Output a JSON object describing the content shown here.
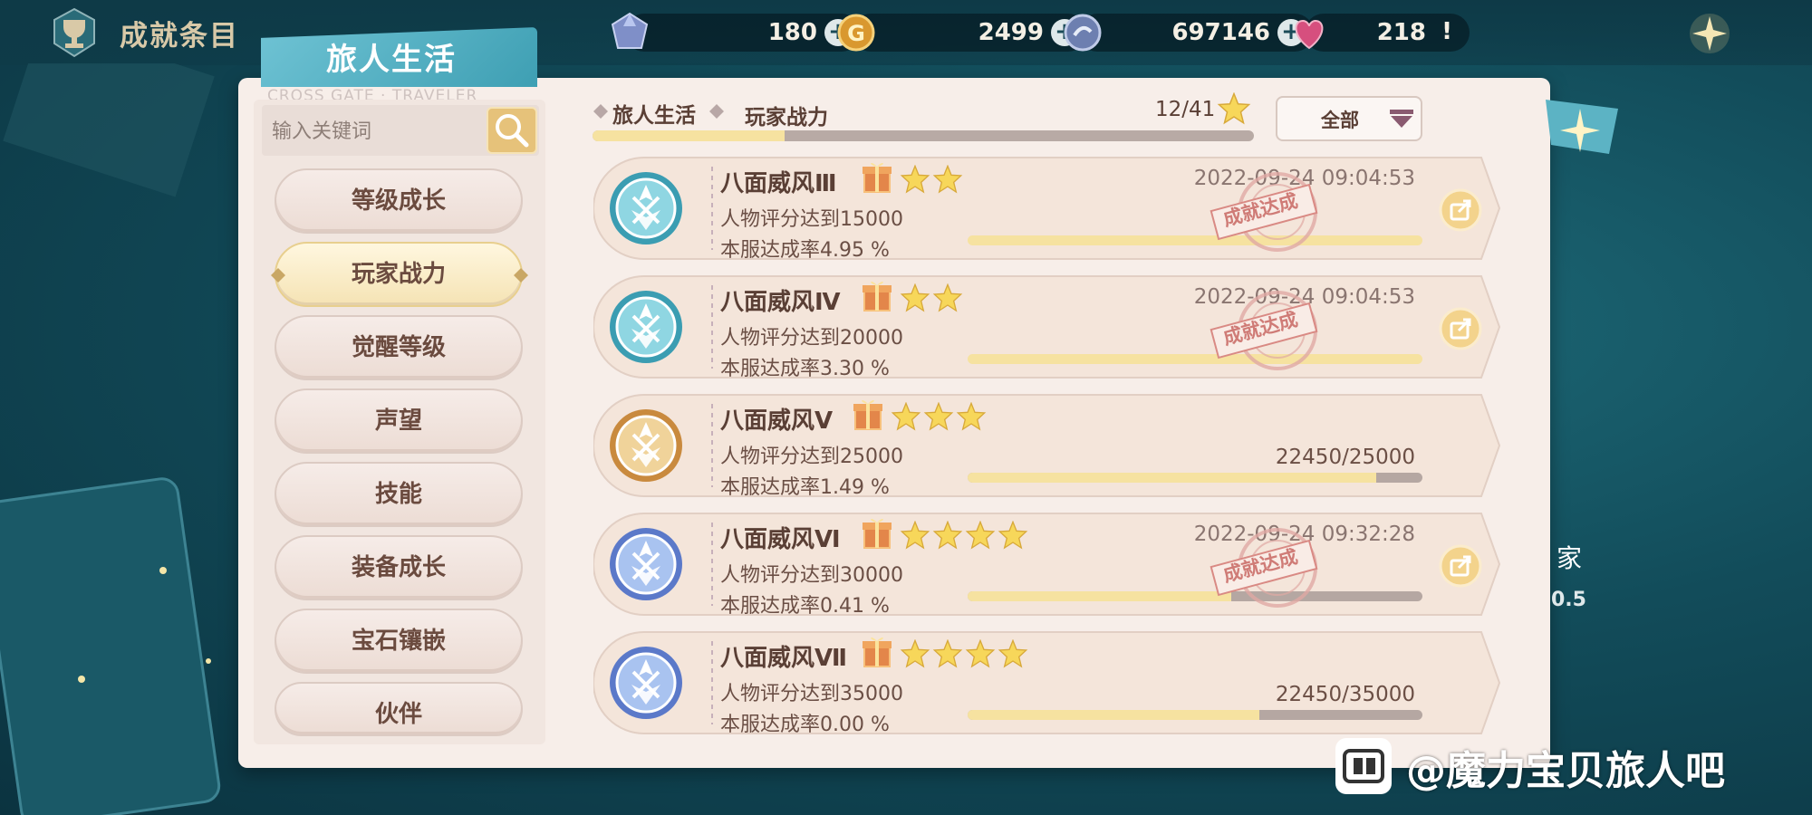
{
  "topbar": {
    "title": "成就条目",
    "resources": [
      {
        "icon": "crystal-icon",
        "value": "180",
        "action": "+"
      },
      {
        "icon": "gold-coin-icon",
        "value": "2499",
        "action": "+"
      },
      {
        "icon": "silver-coin-icon",
        "value": "697146",
        "action": "+"
      },
      {
        "icon": "heart-icon",
        "value": "218",
        "action": "!"
      }
    ]
  },
  "panel": {
    "tab_title": "旅人生活",
    "tab_subtitle": "CROSS GATE · TRAVELER",
    "search_placeholder": "输入关键词",
    "categories": [
      {
        "label": "等级成长",
        "active": false
      },
      {
        "label": "玩家战力",
        "active": true
      },
      {
        "label": "觉醒等级",
        "active": false
      },
      {
        "label": "声望",
        "active": false
      },
      {
        "label": "技能",
        "active": false
      },
      {
        "label": "装备成长",
        "active": false
      },
      {
        "label": "宝石镶嵌",
        "active": false
      },
      {
        "label": "伙伴",
        "active": false
      }
    ],
    "breadcrumb": "旅人生活",
    "breadcrumb_sub": "玩家战力",
    "progress_text": "12/41",
    "progress_fraction": 0.29,
    "filter_label": "全部"
  },
  "achievements": [
    {
      "name": "八面威风Ⅲ",
      "stars": 2,
      "desc": "人物评分达到15000",
      "rate": "本服达成率4.95 %",
      "time": "2022-09-24 09:04:53",
      "count": "",
      "progress": 1.0,
      "completed": true,
      "stamp": "成就达成",
      "medal": "teal"
    },
    {
      "name": "八面威风Ⅳ",
      "stars": 2,
      "desc": "人物评分达到20000",
      "rate": "本服达成率3.30 %",
      "time": "2022-09-24 09:04:53",
      "count": "",
      "progress": 1.0,
      "completed": true,
      "stamp": "成就达成",
      "medal": "teal"
    },
    {
      "name": "八面威风Ⅴ",
      "stars": 3,
      "desc": "人物评分达到25000",
      "rate": "本服达成率1.49 %",
      "time": "",
      "count": "22450/25000",
      "progress": 0.898,
      "completed": false,
      "stamp": "",
      "medal": "gold"
    },
    {
      "name": "八面威风Ⅵ",
      "stars": 4,
      "desc": "人物评分达到30000",
      "rate": "本服达成率0.41 %",
      "time": "2022-09-24 09:32:28",
      "count": "",
      "progress": 0.58,
      "completed": true,
      "stamp": "成就达成",
      "medal": "blue"
    },
    {
      "name": "八面威风Ⅶ",
      "stars": 4,
      "desc": "人物评分达到35000",
      "rate": "本服达成率0.00 %",
      "time": "",
      "count": "22450/35000",
      "progress": 0.641,
      "completed": false,
      "stamp": "",
      "medal": "blue"
    }
  ],
  "side": {
    "text1": "家",
    "text2": "0.5"
  },
  "watermark": "@魔力宝贝旅人吧",
  "colors": {
    "accent_gold": "#f6e2a0",
    "panel_bg": "#f7eee9",
    "tab_teal": "#4aa9bd",
    "text_brown": "#5a3f35"
  }
}
